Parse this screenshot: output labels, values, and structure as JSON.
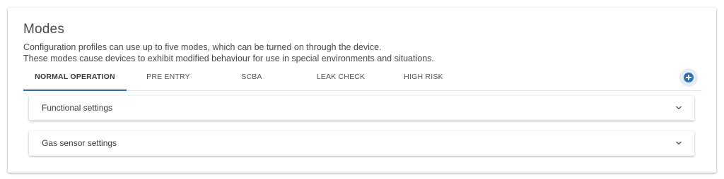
{
  "modes": {
    "title": "Modes",
    "description_line1": "Configuration profiles can use up to five modes, which can be turned on through the device.",
    "description_line2": "These modes cause devices to exhibit modified behaviour for use in special environments and situations.",
    "tabs": [
      {
        "label": "NORMAL OPERATION",
        "active": true
      },
      {
        "label": "PRE ENTRY",
        "active": false
      },
      {
        "label": "SCBA",
        "active": false
      },
      {
        "label": "LEAK CHECK",
        "active": false
      },
      {
        "label": "HIGH RISK",
        "active": false
      }
    ],
    "add_icon": "plus-circle-icon",
    "panels": [
      {
        "label": "Functional settings",
        "icon": "chevron-down-icon"
      },
      {
        "label": "Gas sensor settings",
        "icon": "chevron-down-icon"
      }
    ]
  },
  "colors": {
    "accent": "#2f6db5",
    "text": "#4a4a4a",
    "divider": "#e6e6e6"
  }
}
